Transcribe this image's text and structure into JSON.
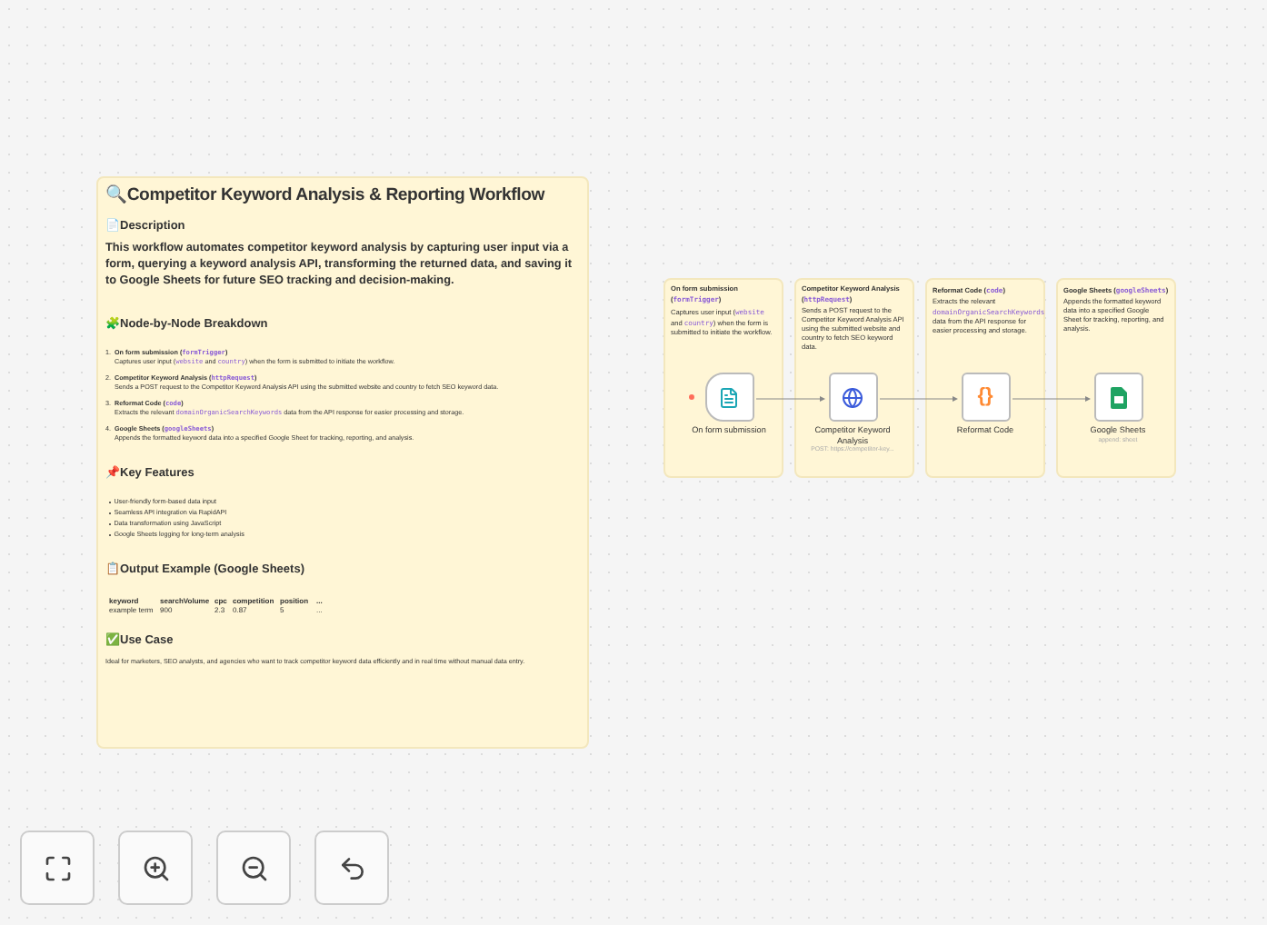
{
  "main_note": {
    "title_icon": "🔍",
    "title": "Competitor Keyword Analysis & Reporting Workflow",
    "description_icon": "📄",
    "description_heading": "Description",
    "description": "This workflow automates competitor keyword analysis by capturing user input via a form, querying a keyword analysis API, transforming the returned data, and saving it to Google Sheets for future SEO tracking and decision-making.",
    "breakdown_icon": "🧩",
    "breakdown_heading": "Node-by-Node Breakdown",
    "breakdown": [
      {
        "number": "1.",
        "title": [
          {
            "kind": "plain",
            "text": "On form submission ("
          },
          {
            "kind": "code",
            "text": "formTrigger"
          },
          {
            "kind": "plain",
            "text": ")"
          }
        ],
        "text": [
          {
            "kind": "plain",
            "text": "Captures user input ("
          },
          {
            "kind": "code",
            "text": "website"
          },
          {
            "kind": "plain",
            "text": " and "
          },
          {
            "kind": "code",
            "text": "country"
          },
          {
            "kind": "plain",
            "text": ") when the form is submitted to initiate the workflow."
          }
        ]
      },
      {
        "number": "2.",
        "title": [
          {
            "kind": "plain",
            "text": "Competitor Keyword Analysis ("
          },
          {
            "kind": "code",
            "text": "httpRequest"
          },
          {
            "kind": "plain",
            "text": ")"
          }
        ],
        "text": [
          {
            "kind": "plain",
            "text": "Sends a POST request to the Competitor Keyword Analysis API using the submitted website and country to fetch SEO keyword data."
          }
        ]
      },
      {
        "number": "3.",
        "title": [
          {
            "kind": "plain",
            "text": "Reformat Code ("
          },
          {
            "kind": "code",
            "text": "code"
          },
          {
            "kind": "plain",
            "text": ")"
          }
        ],
        "text": [
          {
            "kind": "plain",
            "text": "Extracts the relevant "
          },
          {
            "kind": "code",
            "text": "domainOrganicSearchKeywords"
          },
          {
            "kind": "plain",
            "text": " data from the API response for easier processing and storage."
          }
        ]
      },
      {
        "number": "4.",
        "title": [
          {
            "kind": "plain",
            "text": "Google Sheets ("
          },
          {
            "kind": "code",
            "text": "googleSheets"
          },
          {
            "kind": "plain",
            "text": ")"
          }
        ],
        "text": [
          {
            "kind": "plain",
            "text": "Appends the formatted keyword data into a specified Google Sheet for tracking, reporting, and analysis."
          }
        ]
      }
    ],
    "features_icon": "📌",
    "features_heading": "Key Features",
    "features": [
      "User-friendly form-based data input",
      "Seamless API integration via RapidAPI",
      "Data transformation using JavaScript",
      "Google Sheets logging for long-term analysis"
    ],
    "output_icon": "📋",
    "output_heading": "Output Example (Google Sheets)",
    "output_columns": [
      "keyword",
      "searchVolume",
      "cpc",
      "competition",
      "position",
      "..."
    ],
    "output_row": [
      "example term",
      "900",
      "2.3",
      "0.87",
      "5",
      "..."
    ],
    "usecase_icon": "✅",
    "usecase_heading": "Use Case",
    "usecase": "Ideal for marketers, SEO analysts, and agencies who want to track competitor keyword data efficiently and in real time without manual data entry."
  },
  "nodes": [
    {
      "kind": "form",
      "note_title": [
        {
          "kind": "plain",
          "text": "On form submission ("
        },
        {
          "kind": "code",
          "text": "formTrigger"
        },
        {
          "kind": "plain",
          "text": ")"
        }
      ],
      "note_text": [
        {
          "kind": "plain",
          "text": "Captures user input ("
        },
        {
          "kind": "code",
          "text": "website"
        },
        {
          "kind": "plain",
          "text": " and "
        },
        {
          "kind": "code",
          "text": "country"
        },
        {
          "kind": "plain",
          "text": ") when the form is submitted to initiate the workflow."
        }
      ],
      "name": "On form submission",
      "trigger": true
    },
    {
      "kind": "http",
      "note_title": [
        {
          "kind": "plain",
          "text": "Competitor Keyword Analysis ("
        },
        {
          "kind": "code",
          "text": "httpRequest"
        },
        {
          "kind": "plain",
          "text": ")"
        }
      ],
      "note_text": [
        {
          "kind": "plain",
          "text": "Sends a POST request to the Competitor Keyword Analysis API using the submitted website and country to fetch SEO keyword data."
        }
      ],
      "name": "Competitor Keyword Analysis",
      "trigger": false,
      "subtitle": "POST: https://competitor-key..."
    },
    {
      "kind": "code",
      "glyph": "{}",
      "note_title": [
        {
          "kind": "plain",
          "text": "Reformat Code ("
        },
        {
          "kind": "code",
          "text": "code"
        },
        {
          "kind": "plain",
          "text": ")"
        }
      ],
      "note_text": [
        {
          "kind": "plain",
          "text": "Extracts the relevant "
        },
        {
          "kind": "code",
          "text": "domainOrganicSearchKeywords"
        },
        {
          "kind": "plain",
          "text": " data from the API response for easier processing and storage."
        }
      ],
      "name": "Reformat Code",
      "trigger": false
    },
    {
      "kind": "sheets",
      "note_title": [
        {
          "kind": "plain",
          "text": "Google Sheets ("
        },
        {
          "kind": "code",
          "text": "googleSheets"
        },
        {
          "kind": "plain",
          "text": ")"
        }
      ],
      "note_text": [
        {
          "kind": "plain",
          "text": "Appends the formatted keyword data into a specified Google Sheet for tracking, reporting, and analysis."
        }
      ],
      "name": "Google Sheets",
      "trigger": false,
      "subtitle": "append: sheet"
    }
  ],
  "controls": [
    {
      "kind": "fit"
    },
    {
      "kind": "zoom-in"
    },
    {
      "kind": "zoom-out"
    },
    {
      "kind": "undo"
    }
  ]
}
